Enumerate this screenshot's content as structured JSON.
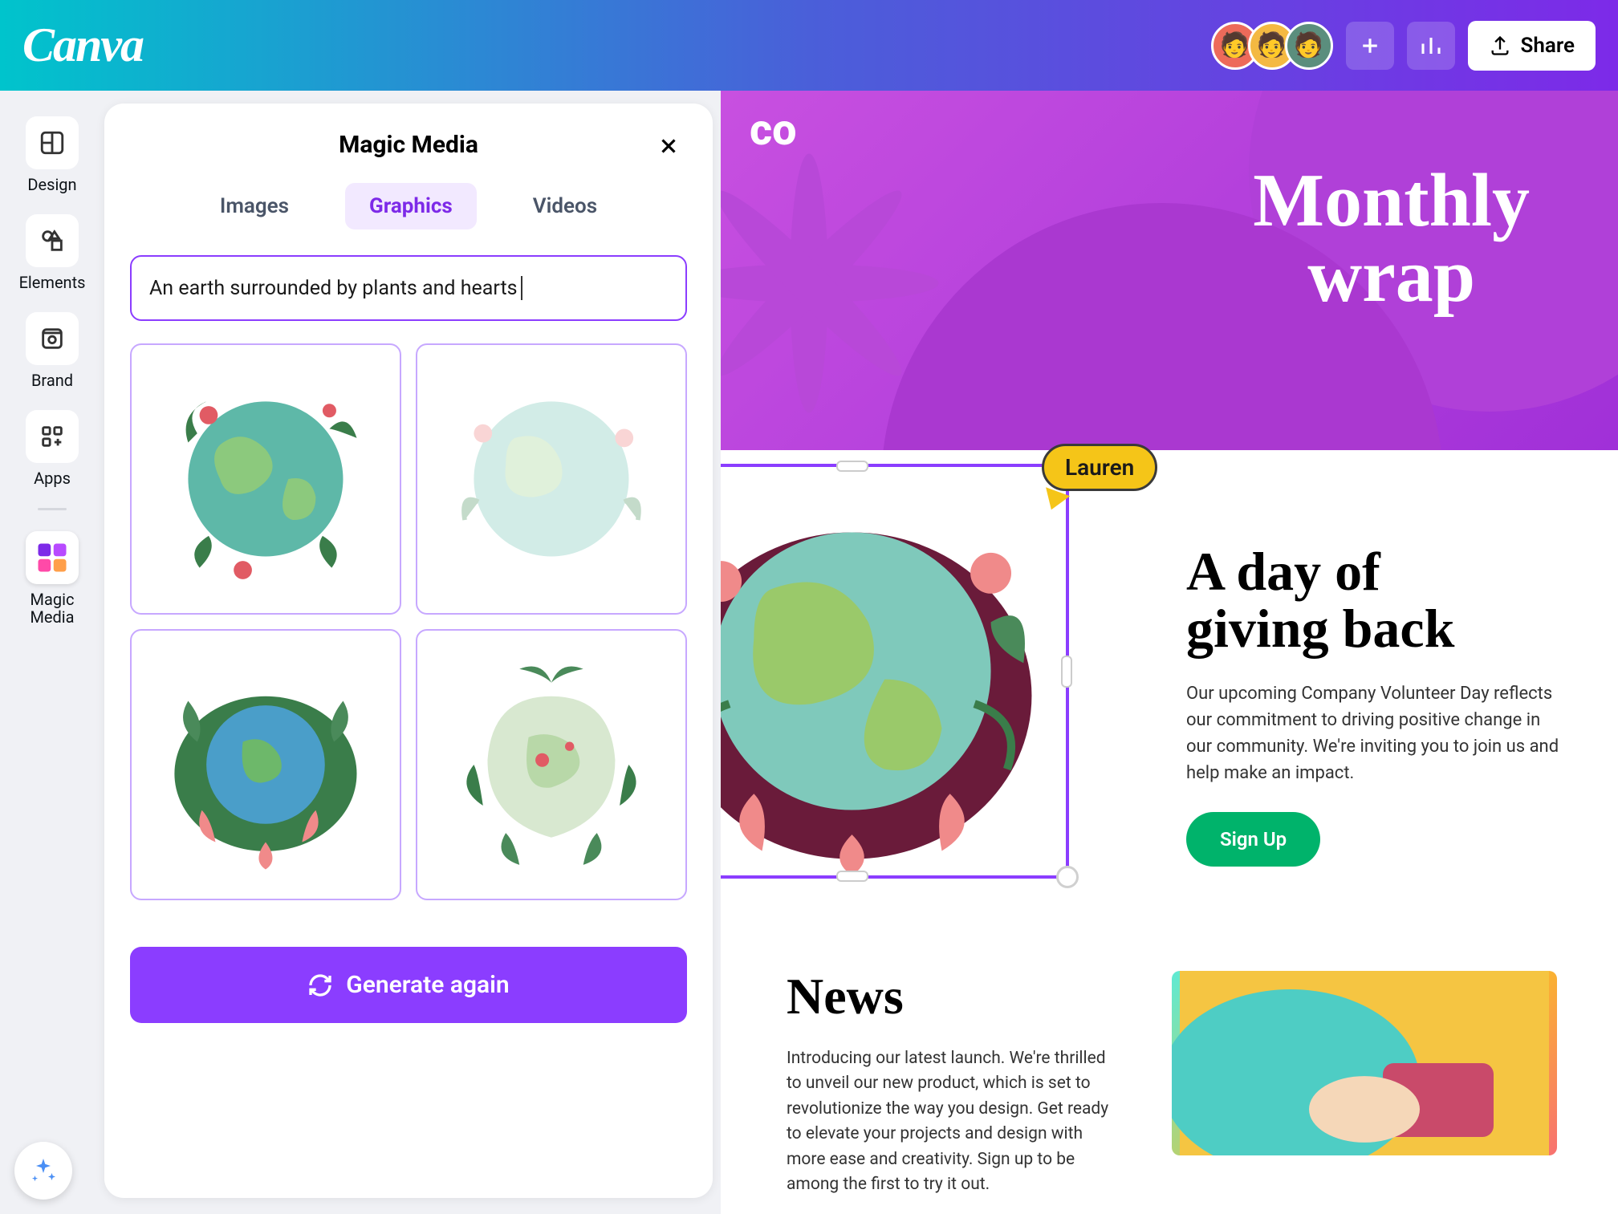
{
  "topbar": {
    "logo": "Canva",
    "share_label": "Share"
  },
  "rail": {
    "items": [
      {
        "label": "Design"
      },
      {
        "label": "Elements"
      },
      {
        "label": "Brand"
      },
      {
        "label": "Apps"
      }
    ],
    "magic_media_label": "Magic\nMedia"
  },
  "panel": {
    "title": "Magic Media",
    "tabs": {
      "images": "Images",
      "graphics": "Graphics",
      "videos": "Videos"
    },
    "prompt_value": "An earth surrounded by plants and hearts",
    "generate_label": "Generate again"
  },
  "collab": {
    "name": "Lauren"
  },
  "doc": {
    "hero_logo": "co",
    "hero_title_line1": "Monthly",
    "hero_title_line2": "wrap",
    "article_title_line1": "A day of",
    "article_title_line2": "giving back",
    "article_body": "Our upcoming Company Volunteer Day reflects our commitment to driving positive change in our community. We're inviting you to join us and help make an impact.",
    "signup_label": "Sign Up",
    "news_title": "News",
    "news_body": "Introducing our latest launch. We're thrilled to unveil our new product, which is set to revolutionize the way you design. Get ready to elevate your projects and design with more ease and creativity. Sign up to be among the first to try it out."
  }
}
